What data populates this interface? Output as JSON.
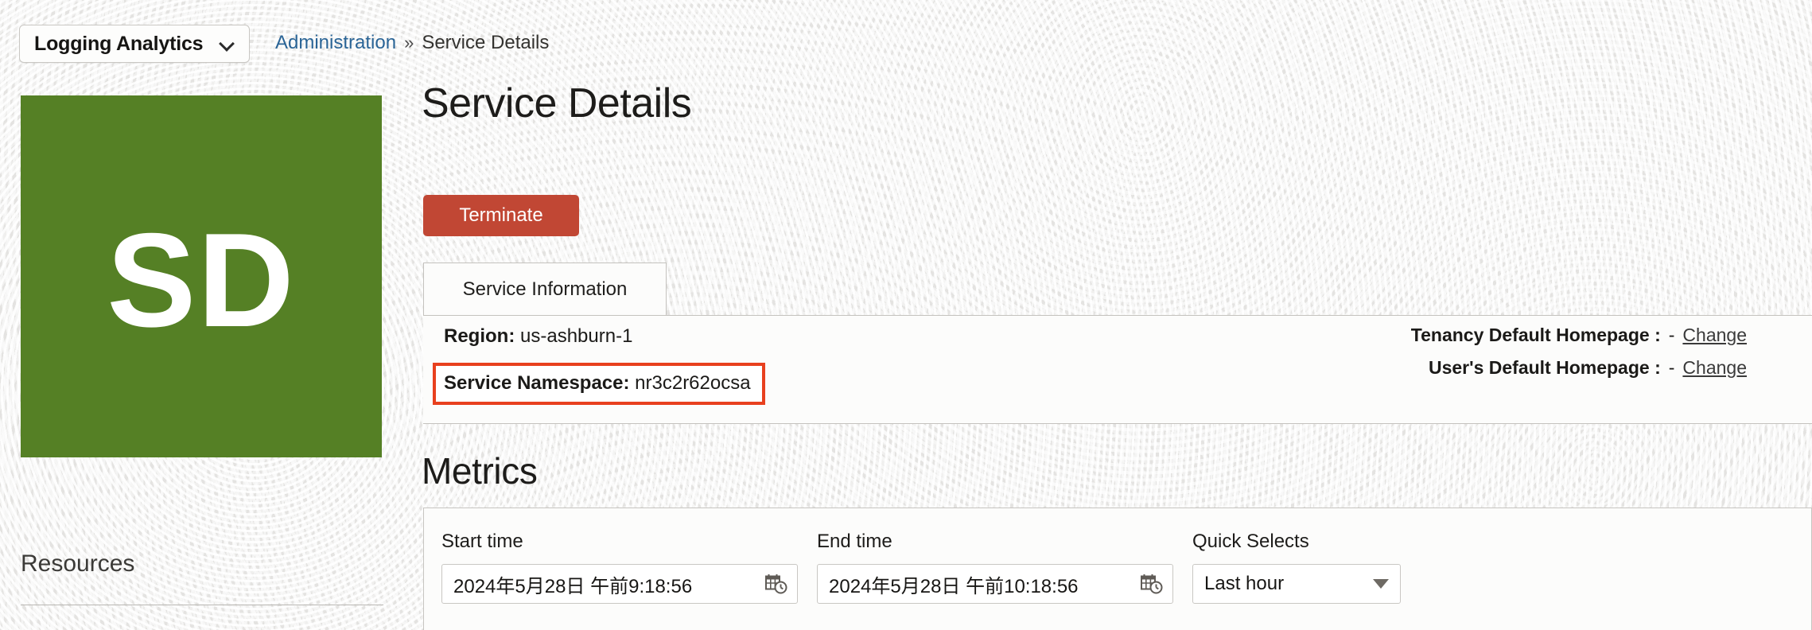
{
  "topbar": {
    "service_selector": {
      "value": "Logging Analytics",
      "icon": "chevron-down-icon"
    },
    "breadcrumb": {
      "parent": "Administration",
      "separator": "»",
      "current": "Service Details"
    }
  },
  "sidebar": {
    "avatar_initials": "SD",
    "avatar_color": "#558025",
    "resources_heading": "Resources"
  },
  "main": {
    "page_title": "Service Details",
    "terminate_label": "Terminate",
    "tabs": [
      {
        "label": "Service Information",
        "active": true
      }
    ],
    "service_info": {
      "region_label": "Region:",
      "region_value": "us-ashburn-1",
      "namespace_label": "Service Namespace:",
      "namespace_value": "nr3c2r62ocsa",
      "highlight_color": "#e8401e",
      "tenancy_homepage_label": "Tenancy Default Homepage :",
      "tenancy_homepage_value": "-",
      "tenancy_homepage_change": "Change",
      "user_homepage_label": "User's Default Homepage :",
      "user_homepage_value": "-",
      "user_homepage_change": "Change"
    },
    "metrics": {
      "title": "Metrics",
      "start_time_label": "Start time",
      "start_time_value": "2024年5月28日 午前9:18:56",
      "end_time_label": "End time",
      "end_time_value": "2024年5月28日 午前10:18:56",
      "quick_selects_label": "Quick Selects",
      "quick_selects_value": "Last hour",
      "calendar_icon": "calendar-clock-icon",
      "dropdown_icon": "triangle-down-icon"
    }
  }
}
